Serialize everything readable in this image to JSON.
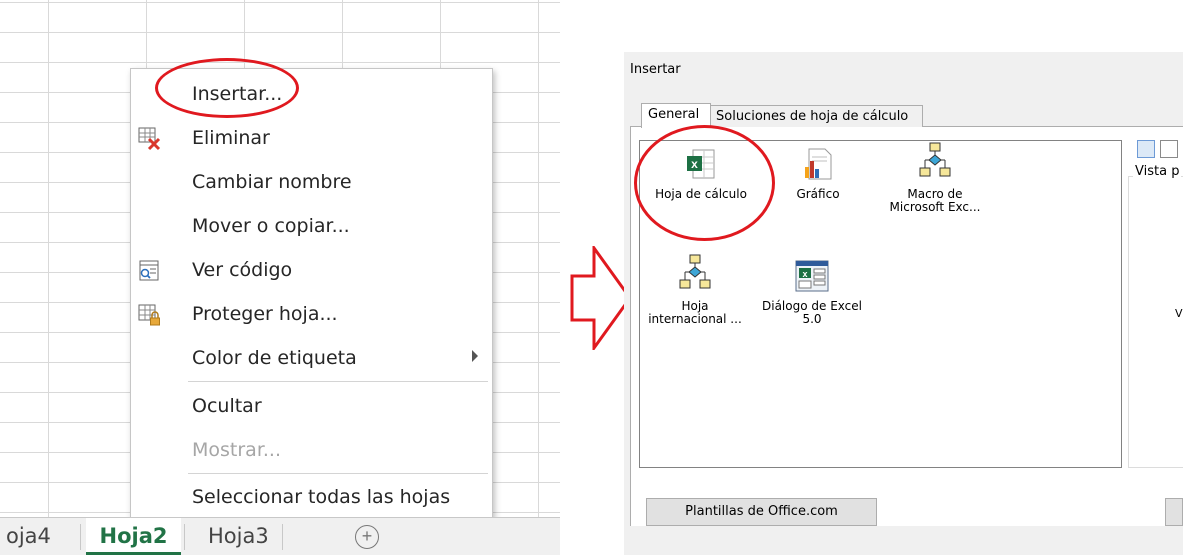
{
  "context_menu": {
    "items": [
      {
        "label": "Insertar..."
      },
      {
        "label": "Eliminar",
        "icon": "delete-sheet-icon"
      },
      {
        "label": "Cambiar nombre"
      },
      {
        "label": "Mover o copiar..."
      },
      {
        "label": "Ver código",
        "icon": "view-code-icon"
      },
      {
        "label": "Proteger hoja...",
        "icon": "protect-sheet-icon"
      },
      {
        "label": "Color de etiqueta"
      },
      {
        "label": "Ocultar"
      },
      {
        "label": "Mostrar...",
        "disabled": true
      },
      {
        "label": "Seleccionar todas las hojas"
      }
    ]
  },
  "sheet_tabs": {
    "tabs": [
      "oja4",
      "Hoja2",
      "Hoja3"
    ],
    "active": "Hoja2",
    "add_symbol": "+",
    "active_color": "#217346"
  },
  "dialog": {
    "title": "Insertar",
    "tabs": [
      "General",
      "Soluciones de hoja de cálculo"
    ],
    "items": [
      {
        "label": "Hoja de cálculo",
        "icon": "worksheet-icon"
      },
      {
        "label": "Gráfico",
        "icon": "chart-icon"
      },
      {
        "label": "Macro de Microsoft Exc...",
        "label_lines": [
          "Macro de",
          "Microsoft Exc..."
        ],
        "icon": "macro-icon"
      },
      {
        "label": "Hoja internacional ...",
        "label_lines": [
          "Hoja",
          "internacional ..."
        ],
        "icon": "international-macro-icon"
      },
      {
        "label": "Diálogo de Excel 5.0",
        "label_lines": [
          "Diálogo de Excel",
          "5.0"
        ],
        "icon": "excel5-dialog-icon"
      }
    ],
    "preview_legend": "Vista p",
    "preview_text": "Vis",
    "templates_button": "Plantillas de Office.com"
  },
  "colors": {
    "highlight_circle": "#e0191f",
    "arrow": "#e0191f"
  }
}
